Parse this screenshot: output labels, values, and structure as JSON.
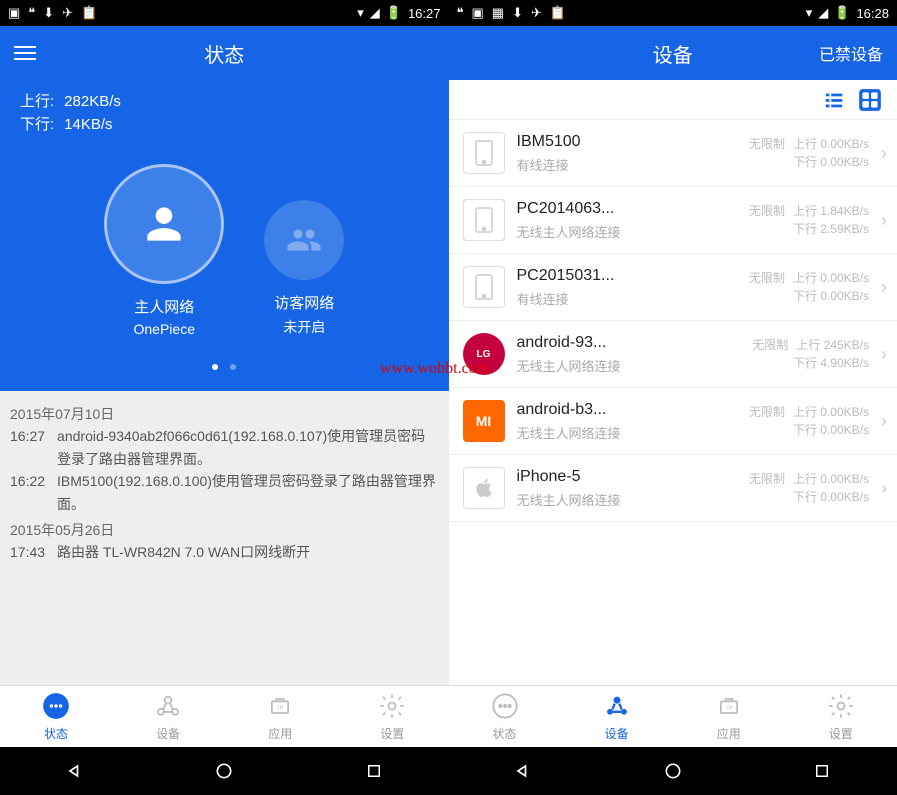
{
  "watermark": "www.wobbt.com",
  "left": {
    "time": "16:27",
    "header_title": "状态",
    "upload_label": "上行:",
    "upload_value": "282KB/s",
    "download_label": "下行:",
    "download_value": "14KB/s",
    "net_main_title": "主人网络",
    "net_main_name": "OnePiece",
    "net_guest_title": "访客网络",
    "net_guest_status": "未开启",
    "logs": [
      {
        "date": "2015年07月10日"
      },
      {
        "time": "16:27",
        "text": "android-9340ab2f066c0d61(192.168.0.107)使用管理员密码登录了路由器管理界面。"
      },
      {
        "time": "16:22",
        "text": "IBM5100(192.168.0.100)使用管理员密码登录了路由器管理界面。"
      },
      {
        "date": "2015年05月26日"
      },
      {
        "time": "17:43",
        "text": "路由器 TL-WR842N 7.0 WAN口网线断开"
      }
    ],
    "tabs": [
      {
        "label": "状态"
      },
      {
        "label": "设备"
      },
      {
        "label": "应用"
      },
      {
        "label": "设置"
      }
    ]
  },
  "right": {
    "time": "16:28",
    "header_title": "设备",
    "header_right": "已禁设备",
    "devices": [
      {
        "name": "IBM5100",
        "conn": "有线连接",
        "limit": "无限制",
        "up": "上行 0.00KB/s",
        "down": "下行 0.00KB/s"
      },
      {
        "name": "PC2014063...",
        "conn": "无线主人网络连接",
        "limit": "无限制",
        "up": "上行 1.84KB/s",
        "down": "下行 2.59KB/s"
      },
      {
        "name": "PC2015031...",
        "conn": "有线连接",
        "limit": "无限制",
        "up": "上行 0.00KB/s",
        "down": "下行 0.00KB/s"
      },
      {
        "name": "android-93...",
        "conn": "无线主人网络连接",
        "limit": "无限制",
        "up": "上行 245KB/s",
        "down": "下行 4.90KB/s"
      },
      {
        "name": "android-b3...",
        "conn": "无线主人网络连接",
        "limit": "无限制",
        "up": "上行 0.00KB/s",
        "down": "下行 0.00KB/s"
      },
      {
        "name": "iPhone-5",
        "conn": "无线主人网络连接",
        "limit": "无限制",
        "up": "上行 0.00KB/s",
        "down": "下行 0.00KB/s"
      }
    ],
    "tabs": [
      {
        "label": "状态"
      },
      {
        "label": "设备"
      },
      {
        "label": "应用"
      },
      {
        "label": "设置"
      }
    ]
  }
}
